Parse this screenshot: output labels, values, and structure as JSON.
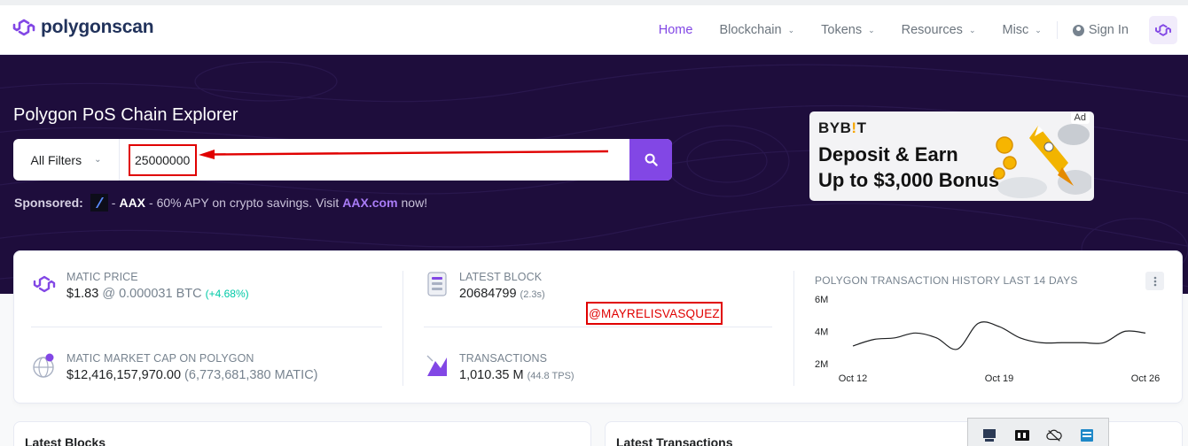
{
  "brand": {
    "name": "polygonscan"
  },
  "nav": {
    "items": [
      {
        "label": "Home",
        "active": true
      },
      {
        "label": "Blockchain"
      },
      {
        "label": "Tokens"
      },
      {
        "label": "Resources"
      },
      {
        "label": "Misc"
      }
    ],
    "sign_in": "Sign In"
  },
  "hero": {
    "title": "Polygon PoS Chain Explorer",
    "filter_label": "All Filters",
    "search_value": "25000000",
    "sponsored": {
      "label": "Sponsored:",
      "brand": "AAX",
      "text": "- 60% APY on crypto savings. Visit",
      "link": "AAX.com",
      "suffix": "now!",
      "dash": "-"
    },
    "ad": {
      "tag": "Ad",
      "brand_a": "BYB",
      "brand_b": "!",
      "brand_c": "T",
      "line1": "Deposit & Earn",
      "line2": "Up to $3,000 Bonus"
    }
  },
  "stats": {
    "matic_price": {
      "label": "MATIC PRICE",
      "value": "$1.83",
      "at": "@ 0.000031 BTC",
      "change": "(+4.68%)"
    },
    "market_cap": {
      "label": "MATIC MARKET CAP ON POLYGON",
      "value": "$12,416,157,970.00",
      "sub": "(6,773,681,380 MATIC)"
    },
    "latest_block": {
      "label": "LATEST BLOCK",
      "value": "20684799",
      "sub": "(2.3s)"
    },
    "transactions": {
      "label": "TRANSACTIONS",
      "value": "1,010.35 M",
      "sub": "(44.8 TPS)"
    },
    "watermark": "@MAYRELISVASQUEZ"
  },
  "chart_data": {
    "type": "line",
    "title": "POLYGON TRANSACTION HISTORY LAST 14 DAYS",
    "y_ticks": [
      "6M",
      "4M",
      "2M"
    ],
    "ylim": [
      2,
      6
    ],
    "x_ticks": [
      "Oct 12",
      "Oct 19",
      "Oct 26"
    ],
    "x": [
      "Oct 12",
      "Oct 13",
      "Oct 14",
      "Oct 15",
      "Oct 16",
      "Oct 17",
      "Oct 18",
      "Oct 19",
      "Oct 20",
      "Oct 21",
      "Oct 22",
      "Oct 23",
      "Oct 24",
      "Oct 25",
      "Oct 26"
    ],
    "values": [
      3.1,
      3.5,
      3.6,
      3.9,
      3.6,
      2.9,
      4.5,
      4.3,
      3.6,
      3.3,
      3.3,
      3.3,
      3.3,
      4.0,
      3.9
    ]
  },
  "sections": {
    "latest_blocks": "Latest Blocks",
    "latest_transactions": "Latest Transactions"
  },
  "colors": {
    "accent": "#8247e5",
    "hero_bg": "#1e0d3c",
    "annotation": "#e00000"
  }
}
